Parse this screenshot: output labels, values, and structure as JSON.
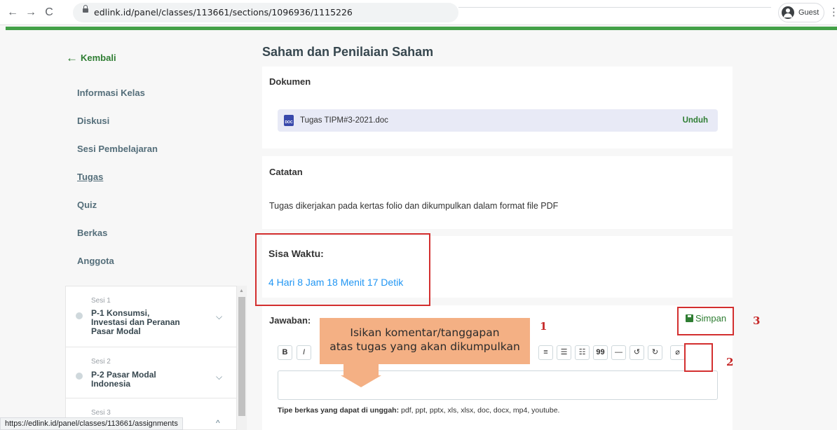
{
  "browser": {
    "url": "edlink.id/panel/classes/113661/sections/1096936/1115226",
    "profile_label": "Guest",
    "status_url": "https://edlink.id/panel/classes/113661/assignments"
  },
  "sidebar": {
    "back_label": "Kembali",
    "items": [
      {
        "label": "Informasi Kelas"
      },
      {
        "label": "Diskusi"
      },
      {
        "label": "Sesi Pembelajaran"
      },
      {
        "label": "Tugas"
      },
      {
        "label": "Quiz"
      },
      {
        "label": "Berkas"
      },
      {
        "label": "Anggota"
      }
    ],
    "sessions": [
      {
        "label": "Sesi 1",
        "title_lines": [
          "P-1 Konsumsi,",
          "Investasi dan Peranan",
          "Pasar Modal"
        ]
      },
      {
        "label": "Sesi 2",
        "title_lines": [
          "P-2 Pasar Modal",
          "Indonesia"
        ]
      },
      {
        "label": "Sesi 3"
      }
    ]
  },
  "main": {
    "title": "Saham dan Penilaian Saham",
    "dokumen": {
      "title": "Dokumen",
      "file_name": "Tugas TIPM#3-2021.doc",
      "file_icon_label": "DOC",
      "download_label": "Unduh"
    },
    "catatan": {
      "title": "Catatan",
      "text": "Tugas dikerjakan pada kertas folio dan dikumpulkan dalam format file PDF"
    },
    "sisa_waktu": {
      "label": "Sisa Waktu:",
      "value": "4 Hari 8 Jam 18 Menit 17 Detik"
    },
    "jawaban": {
      "label": "Jawaban:",
      "save_label": "Simpan",
      "toolbar": [
        "B",
        "I",
        "≡",
        "☰",
        "☷",
        "99",
        "—",
        "↺",
        "↻",
        "⌀"
      ],
      "file_types_label": "Tipe berkas yang dapat di unggah:",
      "file_types": "pdf, ppt, pptx, xls, xlsx, doc, docx, mp4, youtube."
    }
  },
  "annotations": {
    "callout_line1": "Isikan komentar/tanggapan",
    "callout_line2": "atas tugas yang akan dikumpulkan",
    "markers": [
      "1",
      "2",
      "3"
    ]
  }
}
